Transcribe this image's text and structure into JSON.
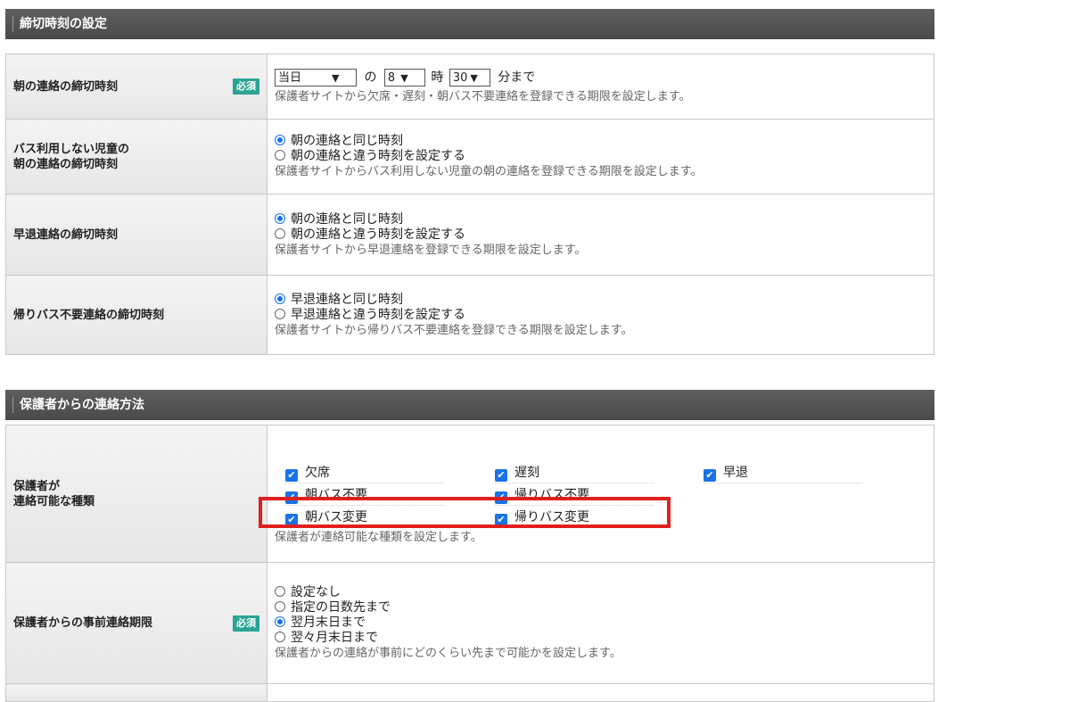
{
  "sections": {
    "deadline": {
      "title": "締切時刻の設定"
    },
    "contact": {
      "title": "保護者からの連絡方法"
    }
  },
  "required_label": "必須",
  "morning": {
    "label": "朝の連絡の締切時刻",
    "day_select": "当日",
    "of": "の",
    "hour_select": "8",
    "hour_unit": "時",
    "minute_select": "30",
    "minute_unit": "分まで",
    "note": "保護者サイトから欠席・遅刻・朝バス不要連絡を登録できる期限を設定します。"
  },
  "nobus": {
    "label_line1": "バス利用しない児童の",
    "label_line2": "朝の連絡の締切時刻",
    "opt1": "朝の連絡と同じ時刻",
    "opt2": "朝の連絡と違う時刻を設定する",
    "note": "保護者サイトからバス利用しない児童の朝の連絡を登録できる期限を設定します。"
  },
  "early": {
    "label": "早退連絡の締切時刻",
    "opt1": "朝の連絡と同じ時刻",
    "opt2": "朝の連絡と違う時刻を設定する",
    "note": "保護者サイトから早退連絡を登録できる期限を設定します。"
  },
  "returnbus": {
    "label": "帰りバス不要連絡の締切時刻",
    "opt1": "早退連絡と同じ時刻",
    "opt2": "早退連絡と違う時刻を設定する",
    "note": "保護者サイトから帰りバス不要連絡を登録できる期限を設定します。"
  },
  "types": {
    "label_line1": "保護者が",
    "label_line2": "連絡可能な種類",
    "items": [
      "欠席",
      "遅刻",
      "早退",
      "朝バス不要",
      "帰りバス不要",
      "朝バス変更",
      "帰りバス変更"
    ],
    "note": "保護者が連絡可能な種類を設定します。"
  },
  "advance": {
    "label": "保護者からの事前連絡期限",
    "opt1": "設定なし",
    "opt2": "指定の日数先まで",
    "opt3": "翌月末日まで",
    "opt4": "翌々月末日まで",
    "note": "保護者からの連絡が事前にどのくらい先まで可能かを設定します。"
  }
}
